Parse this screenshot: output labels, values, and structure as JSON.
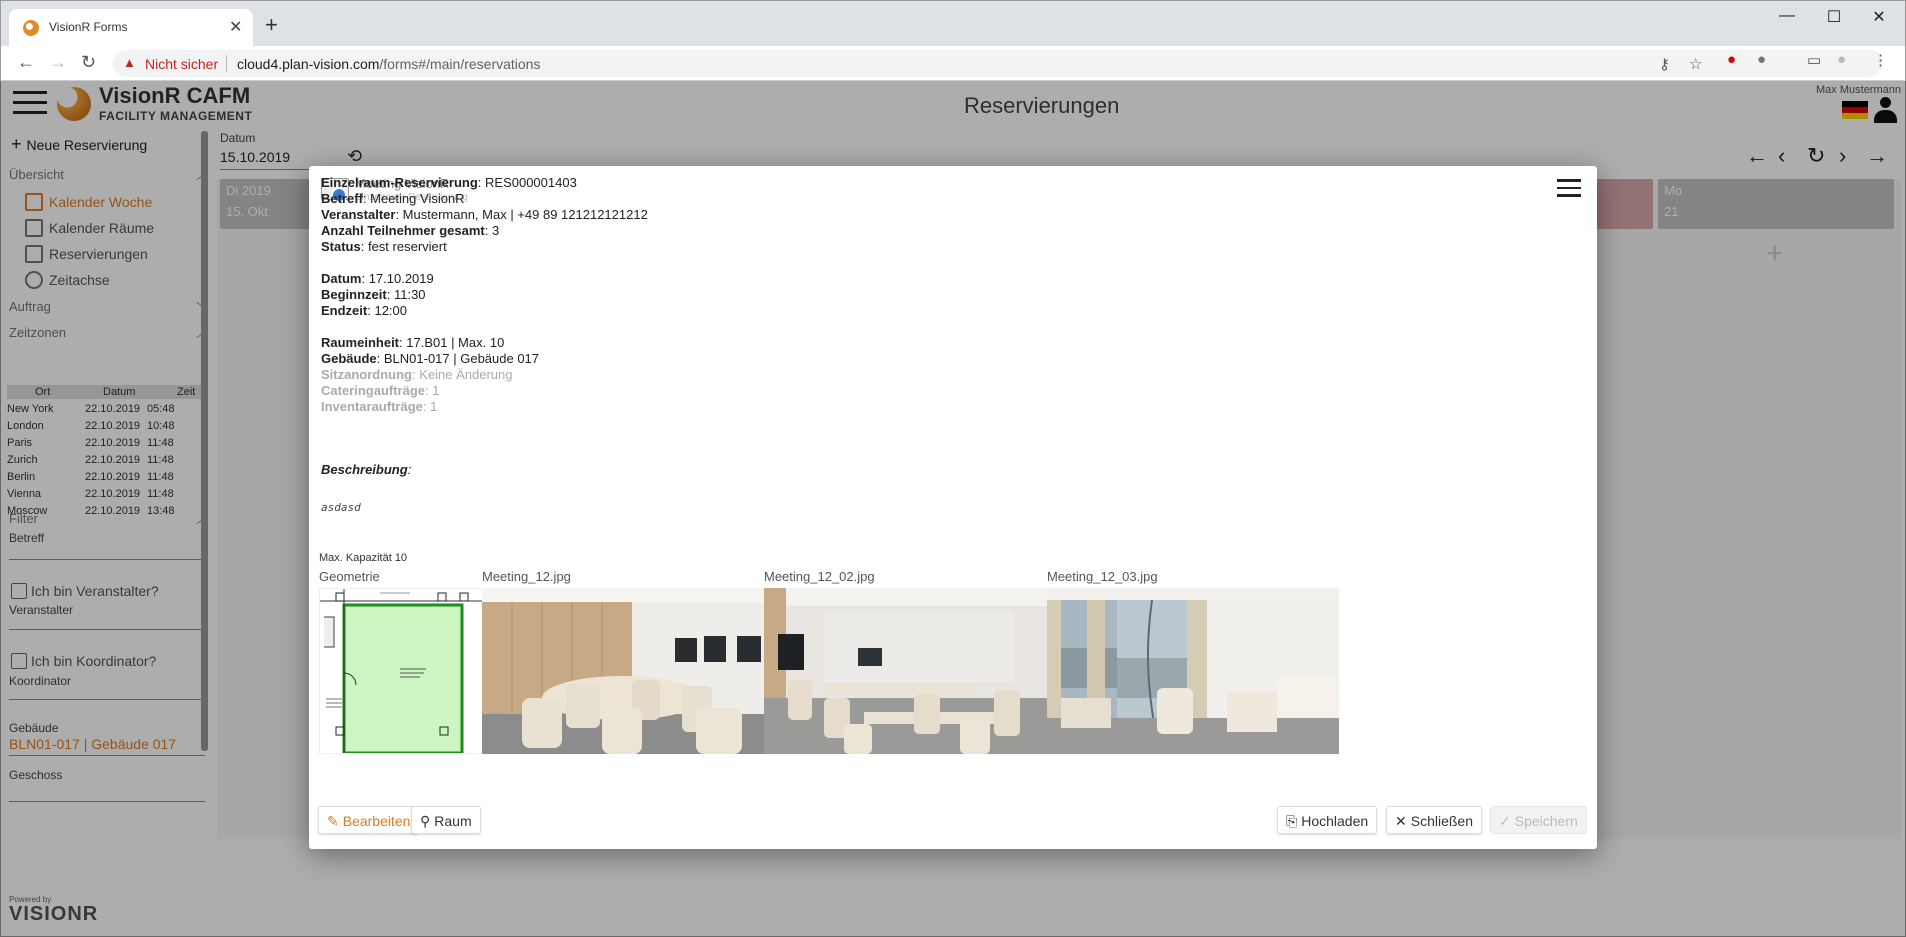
{
  "browser": {
    "tab_title": "VisionR Forms",
    "security_label": "Nicht sicher",
    "url_host": "cloud4.plan-vision.com",
    "url_path": "/forms#/main/reservations"
  },
  "app": {
    "brand": "VisionR CAFM",
    "brand_sub": "FACILITY MANAGEMENT",
    "page_title": "Reservierungen",
    "user_name": "Max Mustermann"
  },
  "sidebar": {
    "new_reservation": "Neue Reservierung",
    "section_overview": "Übersicht",
    "items": [
      {
        "label": "Kalender Woche",
        "active": true
      },
      {
        "label": "Kalender Räume",
        "active": false
      },
      {
        "label": "Reservierungen",
        "active": false
      },
      {
        "label": "Zeitachse",
        "active": false
      }
    ],
    "section_order": "Auftrag",
    "section_timezones": "Zeitzonen",
    "tz_headers": [
      "Ort",
      "Datum",
      "Zeit"
    ],
    "timezones": [
      {
        "city": "New York",
        "date": "22.10.2019",
        "time": "05:48"
      },
      {
        "city": "London",
        "date": "22.10.2019",
        "time": "10:48"
      },
      {
        "city": "Paris",
        "date": "22.10.2019",
        "time": "11:48"
      },
      {
        "city": "Zurich",
        "date": "22.10.2019",
        "time": "11:48"
      },
      {
        "city": "Berlin",
        "date": "22.10.2019",
        "time": "11:48"
      },
      {
        "city": "Vienna",
        "date": "22.10.2019",
        "time": "11:48"
      },
      {
        "city": "Moscow",
        "date": "22.10.2019",
        "time": "13:48"
      }
    ],
    "section_filter": "Filter",
    "filter_subject": "Betreff",
    "chk_organizer": "Ich bin Veranstalter?",
    "lbl_organizer": "Veranstalter",
    "chk_coordinator": "Ich bin Koordinator?",
    "lbl_coordinator": "Koordinator",
    "lbl_building": "Gebäude",
    "val_building": "BLN01-017 | Gebäude 017",
    "lbl_floor": "Geschoss",
    "powered": "Powered by",
    "powered_brand": "VISIONR"
  },
  "calendar": {
    "date_label": "Datum",
    "date_value": "15.10.2019",
    "day1_line1": "Di 2019",
    "day1_line2": "15. Okt",
    "day_last_line1": "Mo",
    "day_last_line2": "21"
  },
  "dialog": {
    "title": "Meeting VisionR",
    "subtitle": "Einzelraum-Reservierung",
    "fields": [
      {
        "k": "Einzelraum-Reservierung",
        "v": "RES000001403"
      },
      {
        "k": "Betreff",
        "v": "Meeting VisionR"
      },
      {
        "k": "Veranstalter",
        "v": "Mustermann, Max | +49 89 121212121212"
      },
      {
        "k": "Anzahl Teilnehmer gesamt",
        "v": "3"
      },
      {
        "k": "Status",
        "v": "fest reserviert"
      },
      {
        "k": "Datum",
        "v": "17.10.2019"
      },
      {
        "k": "Beginnzeit",
        "v": "11:30"
      },
      {
        "k": "Endzeit",
        "v": "12:00"
      },
      {
        "k": "Raumeinheit",
        "v": "17.B01 | Max. 10"
      },
      {
        "k": "Gebäude",
        "v": "BLN01-017 | Gebäude 017"
      },
      {
        "k": "Sitzanordnung",
        "v": "Keine Änderung"
      },
      {
        "k": "Cateringaufträge",
        "v": "1"
      },
      {
        "k": "Inventaraufträge",
        "v": "1"
      }
    ],
    "desc_label": "Beschreibung",
    "desc_value": "asdasd",
    "max_capacity": "Max. Kapazität 10",
    "images": [
      "Geometrie",
      "Meeting_12.jpg",
      "Meeting_12_02.jpg",
      "Meeting_12_03.jpg"
    ],
    "btn_edit": "Bearbeiten",
    "btn_room": "Raum",
    "btn_upload": "Hochladen",
    "btn_close": "Schließen",
    "btn_save": "Speichern"
  }
}
